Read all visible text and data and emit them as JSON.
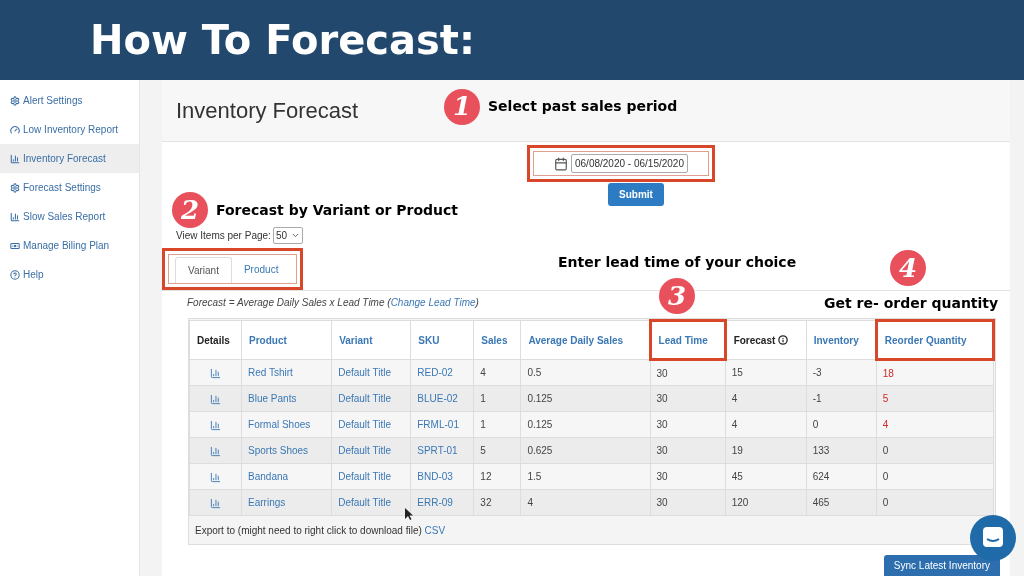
{
  "banner": {
    "title": "How To Forecast:"
  },
  "sidebar": {
    "items": [
      {
        "label": "Alert Settings",
        "kind": "gear",
        "selected": false
      },
      {
        "label": "Low Inventory Report",
        "kind": "gauge",
        "selected": false
      },
      {
        "label": "Inventory Forecast",
        "kind": "chart",
        "selected": true
      },
      {
        "label": "Forecast Settings",
        "kind": "gear",
        "selected": false
      },
      {
        "label": "Slow Sales Report",
        "kind": "chart",
        "selected": false
      },
      {
        "label": "Manage Biling Plan",
        "kind": "money",
        "selected": false
      },
      {
        "label": "Help",
        "kind": "help",
        "selected": false
      }
    ]
  },
  "page": {
    "title": "Inventory Forecast"
  },
  "annotations": [
    {
      "number": "1",
      "text": "Select past sales period"
    },
    {
      "number": "2",
      "text": "Forecast  by Variant or Product"
    },
    {
      "number": "3",
      "text": "Enter lead time of your choice"
    },
    {
      "number": "4",
      "text": "Get re- order quantity"
    }
  ],
  "date_range": {
    "value": "06/08/2020 - 06/15/2020",
    "highlighted": true
  },
  "submit_button": "Submit",
  "per_page": {
    "label": "View Items per Page:",
    "value": "50"
  },
  "tabs": {
    "highlighted": true,
    "items": [
      {
        "label": "Variant",
        "selected": true
      },
      {
        "label": "Product",
        "selected": false
      }
    ]
  },
  "formula": {
    "text": "Forecast = Average Daily Sales x Lead Time (",
    "link": "Change Lead Time",
    "end": ")"
  },
  "table": {
    "columns": [
      {
        "label": "Details",
        "sortable": false,
        "highlighted": false,
        "info": false
      },
      {
        "label": "Product",
        "sortable": true,
        "highlighted": false,
        "info": false
      },
      {
        "label": "Variant",
        "sortable": true,
        "highlighted": false,
        "info": false
      },
      {
        "label": "SKU",
        "sortable": true,
        "highlighted": false,
        "info": false
      },
      {
        "label": "Sales",
        "sortable": true,
        "highlighted": false,
        "info": false
      },
      {
        "label": "Average Daily Sales",
        "sortable": true,
        "highlighted": false,
        "info": false
      },
      {
        "label": "Lead Time",
        "sortable": true,
        "highlighted": true,
        "info": false
      },
      {
        "label": "Forecast",
        "sortable": false,
        "highlighted": false,
        "info": true
      },
      {
        "label": "Inventory",
        "sortable": true,
        "highlighted": false,
        "info": false
      },
      {
        "label": "Reorder Quantity",
        "sortable": true,
        "highlighted": true,
        "info": false
      }
    ],
    "rows": [
      {
        "product": "Red Tshirt",
        "variant": "Default Title",
        "sku": "RED-02",
        "sales": "4",
        "avg_daily_sales": "0.5",
        "lead_time": "30",
        "forecast": "15",
        "inventory": "-3",
        "reorder_quantity": "18",
        "urgent": true
      },
      {
        "product": "Blue Pants",
        "variant": "Default Title",
        "sku": "BLUE-02",
        "sales": "1",
        "avg_daily_sales": "0.125",
        "lead_time": "30",
        "forecast": "4",
        "inventory": "-1",
        "reorder_quantity": "5",
        "urgent": true
      },
      {
        "product": "Formal Shoes",
        "variant": "Default Title",
        "sku": "FRML-01",
        "sales": "1",
        "avg_daily_sales": "0.125",
        "lead_time": "30",
        "forecast": "4",
        "inventory": "0",
        "reorder_quantity": "4",
        "urgent": true
      },
      {
        "product": "Sports Shoes",
        "variant": "Default Title",
        "sku": "SPRT-01",
        "sales": "5",
        "avg_daily_sales": "0.625",
        "lead_time": "30",
        "forecast": "19",
        "inventory": "133",
        "reorder_quantity": "0",
        "urgent": false
      },
      {
        "product": "Bandana",
        "variant": "Default Title",
        "sku": "BND-03",
        "sales": "12",
        "avg_daily_sales": "1.5",
        "lead_time": "30",
        "forecast": "45",
        "inventory": "624",
        "reorder_quantity": "0",
        "urgent": false
      },
      {
        "product": "Earrings",
        "variant": "Default Title",
        "sku": "ERR-09",
        "sales": "32",
        "avg_daily_sales": "4",
        "lead_time": "30",
        "forecast": "120",
        "inventory": "465",
        "reorder_quantity": "0",
        "urgent": false
      }
    ]
  },
  "export": {
    "text": "Export to (might need to right click to download file)",
    "link": "CSV"
  },
  "sync_button": "Sync Latest Inventory"
}
